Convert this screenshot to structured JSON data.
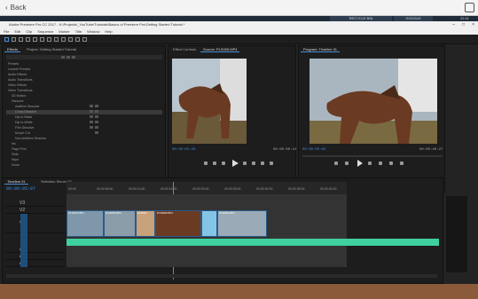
{
  "remote": {
    "back_label": "Back",
    "buttons": [
      "RECYCLE BIN",
      "GOOGLE"
    ],
    "clock": "22:11"
  },
  "app": {
    "title": "Adobe Premiere Pro CC 2017 - K:\\Projects\\_YouTube\\Tutorials\\Basics of Premiere Pro\\Getting Started Tutorial *",
    "menu": [
      "File",
      "Edit",
      "Clip",
      "Sequence",
      "Marker",
      "Title",
      "Window",
      "Help"
    ]
  },
  "effects_panel": {
    "tabs": [
      "Effects",
      "Project: Getting Started Tutorial"
    ],
    "items": [
      "Presets",
      "Lumetri Presets",
      "Audio Effects",
      "Audio Transitions",
      "Video Effects",
      "Video Transitions",
      "3D Motion",
      "Dissolve",
      "Additive Dissolve",
      "Cross Dissolve",
      "Dip to Black",
      "Dip to White",
      "Film Dissolve",
      "Morph Cut",
      "Non-Additive Dissolve",
      "Iris",
      "Page Peel",
      "Slide",
      "Wipe",
      "Zoom"
    ]
  },
  "source_monitor": {
    "tabs": [
      "Effect Controls",
      "Source: PLS005.MP4"
    ],
    "timecode": "00:00:05:23",
    "duration": "00:00:00:12"
  },
  "program_monitor": {
    "tabs": [
      "Program: Timeline 01"
    ],
    "timecode": "00:00:05:05",
    "duration": "00:00:40:27"
  },
  "timeline": {
    "tabs": [
      "Timeline 01",
      "Selection Sinner 03"
    ],
    "timecode": "00:00:05:07",
    "ruler": [
      "00:00",
      "00:00:05:00",
      "00:00:10:00",
      "00:00:15:00",
      "00:00:20:00",
      "00:00:25:00",
      "00:00:30:00",
      "00:00:35:00",
      "00:00:40:00",
      "00:00:45:00"
    ],
    "video_tracks": [
      "V3",
      "V2",
      "V1"
    ],
    "audio_tracks": [
      "A1",
      "A2",
      "A3"
    ],
    "clips": [
      "PLS003.MP4",
      "PLS005.MP4",
      "PLS006",
      "PLS008.MP4",
      "PLS009.MP4"
    ]
  },
  "colors": {
    "accent": "#4d8fd8",
    "timecode": "#3f8fe0",
    "audio_clip": "#3fd0a0",
    "video_clip": "#2a5a8a"
  }
}
